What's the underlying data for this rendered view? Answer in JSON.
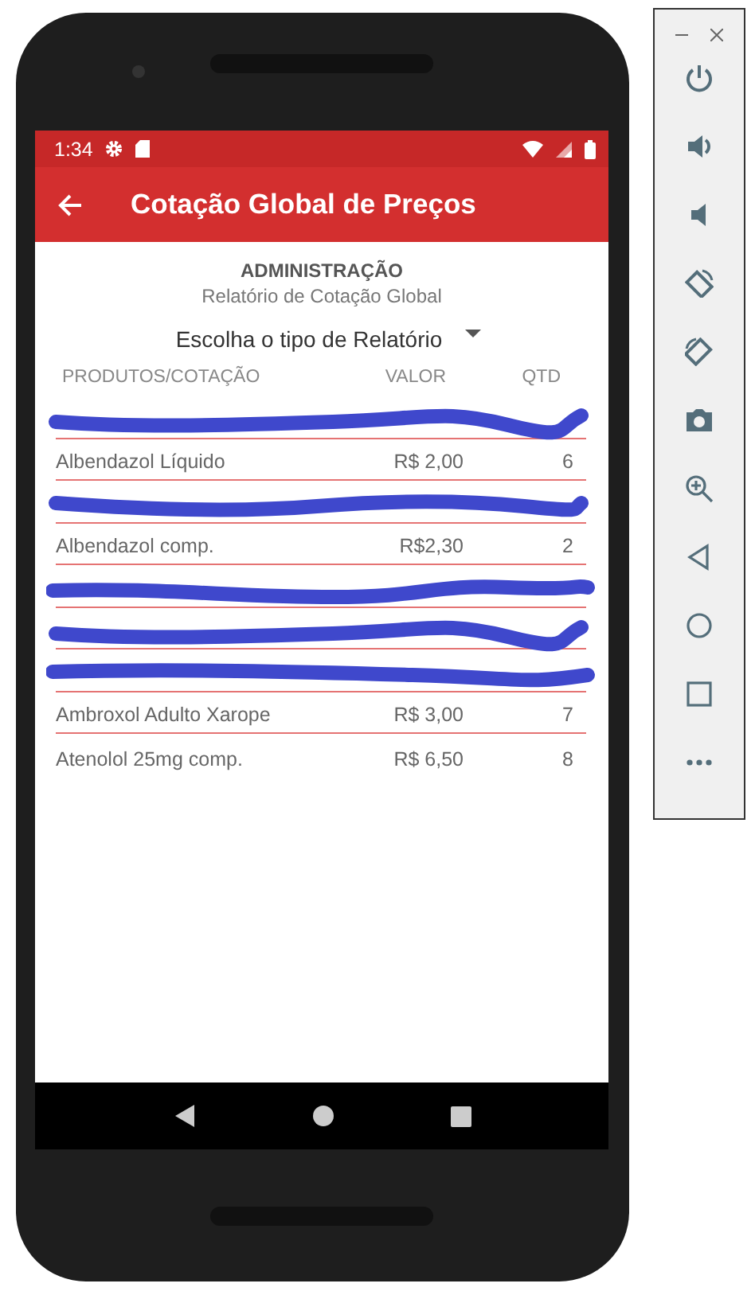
{
  "status_bar": {
    "time": "1:34"
  },
  "app_bar": {
    "title": "Cotação Global de Preços"
  },
  "header": {
    "section": "ADMINISTRAÇÃO",
    "subtitle": "Relatório de Cotação Global"
  },
  "report_type_dropdown": {
    "value": "Escolha o tipo de Relatório"
  },
  "table": {
    "columns": [
      "PRODUTOS/COTAÇÃO",
      "VALOR",
      "QTD"
    ],
    "rows": [
      {
        "kind": "redacted"
      },
      {
        "kind": "item",
        "product": "Albendazol Líquido",
        "value": "R$ 2,00",
        "qty": "6"
      },
      {
        "kind": "redacted"
      },
      {
        "kind": "item",
        "product": "Albendazol comp.",
        "value": "R$2,30",
        "qty": "2"
      },
      {
        "kind": "redacted"
      },
      {
        "kind": "redacted"
      },
      {
        "kind": "redacted"
      },
      {
        "kind": "item",
        "product": "Ambroxol Adulto Xarope",
        "value": "R$ 3,00",
        "qty": "7"
      },
      {
        "kind": "item",
        "product": "Atenolol 25mg comp.",
        "value": "R$ 6,50",
        "qty": "8"
      }
    ]
  }
}
